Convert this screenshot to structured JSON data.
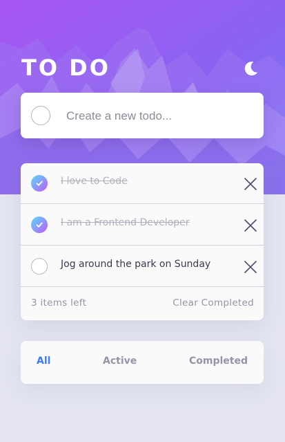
{
  "header": {
    "title": "TO DO",
    "theme_icon": "moon-icon"
  },
  "new_todo": {
    "placeholder": "Create a new todo...",
    "value": ""
  },
  "todos": [
    {
      "text": "I love to Code",
      "completed": true
    },
    {
      "text": "I am a Frontend Developer",
      "completed": true
    },
    {
      "text": "Jog around the park on Sunday",
      "completed": false
    }
  ],
  "footer": {
    "items_left": "3 items left",
    "clear_completed": "Clear Completed"
  },
  "filters": {
    "all": "All",
    "active": "Active",
    "completed": "Completed",
    "selected": "All"
  },
  "colors": {
    "accent": "#3a7bfd",
    "check_gradient_start": "#57ddff",
    "check_gradient_end": "#c058f3",
    "background": "#e4e5f1"
  }
}
